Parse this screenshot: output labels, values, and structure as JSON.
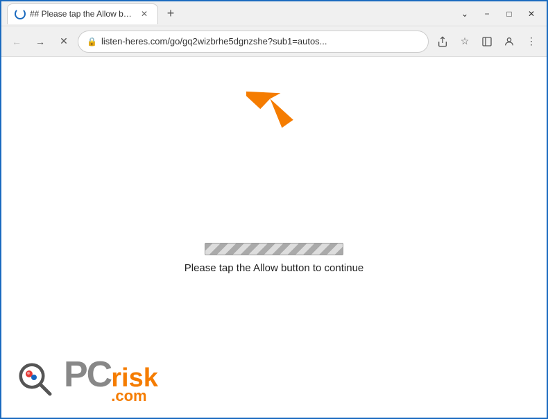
{
  "window": {
    "title": "## Please tap the Allow button t...",
    "controls": {
      "minimize": "−",
      "maximize": "□",
      "close": "✕"
    }
  },
  "tab": {
    "title": "## Please tap the Allow button t...",
    "close_label": "✕"
  },
  "new_tab_button_label": "+",
  "toolbar": {
    "back_title": "←",
    "forward_title": "→",
    "reload_title": "✕",
    "address": "listen-heres.com/go/gq2wizbrhe5dgnzshe?sub1=autos...",
    "share_icon": "share",
    "bookmark_icon": "★",
    "sidebar_icon": "□",
    "profile_icon": "👤",
    "menu_icon": "⋮"
  },
  "page": {
    "progress_message": "Please tap the Allow button to continue"
  },
  "logo": {
    "pc_text": "PC",
    "risk_text": "risk",
    "dot_com": ".com"
  }
}
